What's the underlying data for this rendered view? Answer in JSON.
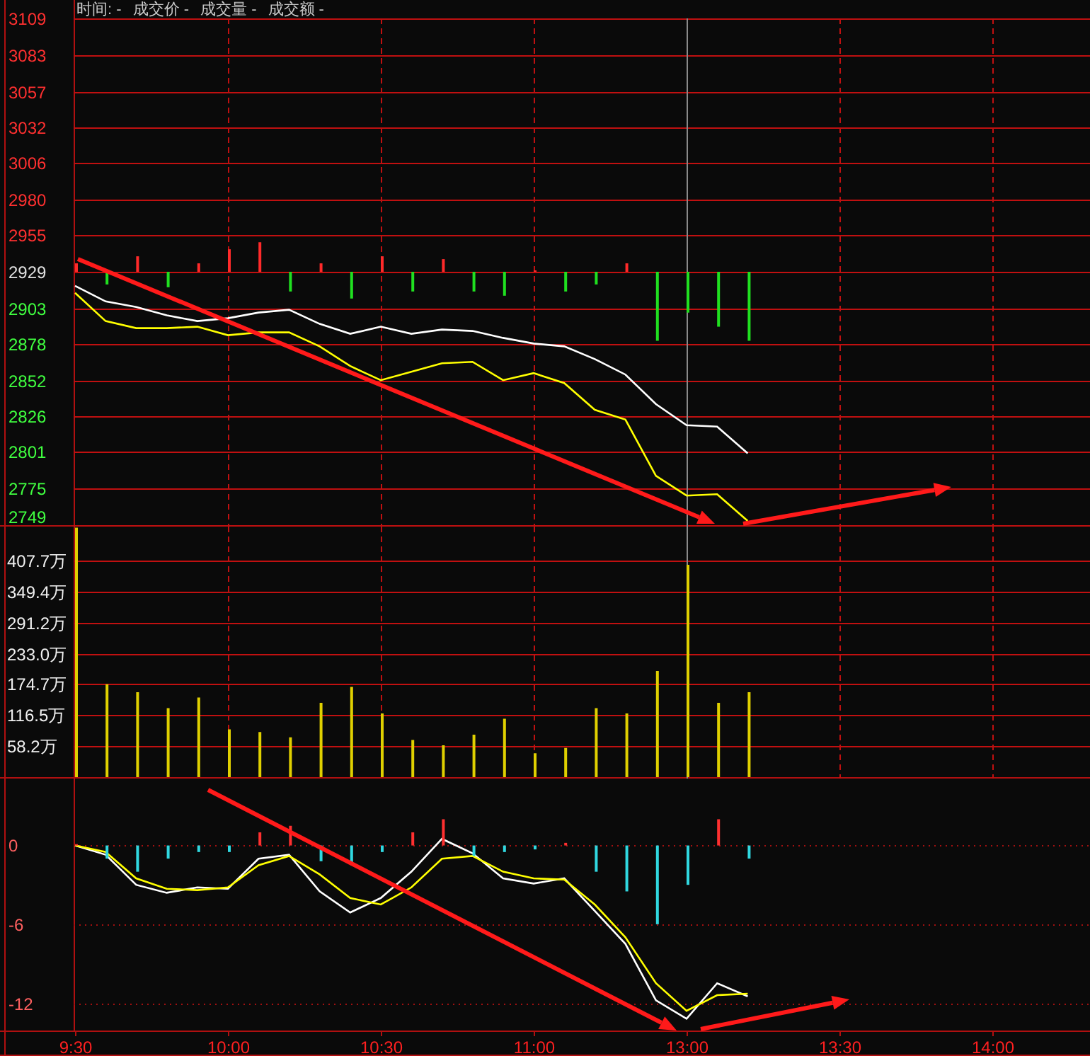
{
  "header": [
    "时间: -",
    "成交价 -",
    "成交量 -",
    "成交额 -"
  ],
  "price_panel": {
    "chart_data": {
      "type": "line",
      "ylim": [
        2749,
        3109
      ],
      "yticks": [
        3109,
        3083,
        3057,
        3032,
        3006,
        2980,
        2955,
        2929,
        2903,
        2878,
        2852,
        2826,
        2801,
        2775,
        2749
      ],
      "grid": true,
      "series": [
        {
          "color": "#ffffff",
          "values": [
            2919,
            2908,
            2904,
            2898,
            2894,
            2896,
            2900,
            2902,
            2892,
            2885,
            2890,
            2885,
            2888,
            2887,
            2882,
            2878,
            2876,
            2867,
            2856,
            2835,
            2820,
            2819,
            2800,
            null,
            null,
            null,
            null,
            null,
            null,
            null,
            null,
            null,
            null,
            null
          ]
        },
        {
          "color": "#ffff00",
          "values": [
            2914,
            2894,
            2889,
            2889,
            2890,
            2884,
            2886,
            2886,
            2876,
            2862,
            2852,
            2858,
            2864,
            2865,
            2852,
            2857,
            2850,
            2831,
            2824,
            2784,
            2770,
            2771,
            2752,
            null,
            null,
            null,
            null,
            null,
            null,
            null,
            null,
            null,
            null,
            null
          ]
        }
      ]
    }
  },
  "volume_panel": {
    "chart_data": {
      "type": "bar",
      "ylim": [
        0,
        472
      ],
      "grid": true,
      "yticks": [
        {
          "value": 407.7,
          "label": "407.7万"
        },
        {
          "value": 349.4,
          "label": "349.4万"
        },
        {
          "value": 291.2,
          "label": "291.2万"
        },
        {
          "value": 233.0,
          "label": "233.0万"
        },
        {
          "value": 174.7,
          "label": "174.7万"
        },
        {
          "value": 116.5,
          "label": "116.5万"
        },
        {
          "value": 58.2,
          "label": "58.2万"
        }
      ],
      "series": [
        {
          "color": "#e0d000",
          "values": [
            470,
            175,
            160,
            130,
            150,
            90,
            85,
            75,
            140,
            170,
            120,
            70,
            60,
            80,
            110,
            45,
            55,
            130,
            120,
            200,
            400,
            140,
            160,
            null,
            null,
            null,
            null,
            null,
            null,
            null,
            null,
            null,
            null,
            null
          ]
        }
      ]
    }
  },
  "macd_panel": {
    "chart_data": {
      "type": "line",
      "ylim": [
        -14.1,
        5.1
      ],
      "grid": true,
      "yticks": [
        0,
        -6,
        -12
      ],
      "categories": [
        "9:30",
        null,
        null,
        null,
        null,
        "10:00",
        null,
        null,
        null,
        null,
        "10:30",
        null,
        null,
        null,
        null,
        "11:00",
        null,
        null,
        null,
        null,
        "13:00",
        null,
        null,
        null,
        null,
        "13:30",
        null,
        null,
        null,
        null,
        "14:00",
        null,
        null,
        null
      ],
      "series": [
        {
          "color": "#ffffff",
          "values": [
            0,
            -0.7,
            -3,
            -3.6,
            -3.2,
            -3.3,
            -1,
            -0.7,
            -3.5,
            -5.1,
            -4,
            -2,
            0.5,
            -0.6,
            -2.5,
            -2.9,
            -2.5,
            -5,
            -7.5,
            -11.8,
            -13.2,
            -10.5,
            -11.5,
            null,
            null,
            null,
            null,
            null,
            null,
            null,
            null,
            null,
            null,
            null
          ]
        },
        {
          "color": "#ffff00",
          "values": [
            0,
            -0.5,
            -2.5,
            -3.3,
            -3.4,
            -3.2,
            -1.5,
            -0.8,
            -2.2,
            -4,
            -4.5,
            -3.2,
            -1,
            -0.8,
            -2,
            -2.5,
            -2.6,
            -4.5,
            -7,
            -10.5,
            -12.6,
            -11.4,
            -11.3,
            null,
            null,
            null,
            null,
            null,
            null,
            null,
            null,
            null,
            null,
            null
          ]
        },
        {
          "type": "bar",
          "values": [
            0.1,
            -1,
            -2,
            -1,
            -0.5,
            -0.5,
            1,
            1.5,
            -1.2,
            -1.5,
            -0.5,
            1,
            2,
            -0.8,
            -0.5,
            -0.3,
            0.2,
            -2,
            -3.5,
            -6,
            -3,
            2,
            -1,
            null,
            null,
            null,
            null,
            null,
            null,
            null,
            null,
            null,
            null,
            null
          ],
          "colors": [
            "#ff3030",
            "#30d8e0",
            "#30d8e0",
            "#30d8e0",
            "#30d8e0",
            "#30d8e0",
            "#ff3030",
            "#ff3030",
            "#30d8e0",
            "#30d8e0",
            "#30d8e0",
            "#ff3030",
            "#ff3030",
            "#30d8e0",
            "#30d8e0",
            "#30d8e0",
            "#ff3030",
            "#30d8e0",
            "#30d8e0",
            "#30d8e0",
            "#30d8e0",
            "#ff3030",
            "#30d8e0",
            null,
            null,
            null,
            null,
            null,
            null,
            null,
            null,
            null,
            null,
            null
          ]
        }
      ]
    }
  }
}
